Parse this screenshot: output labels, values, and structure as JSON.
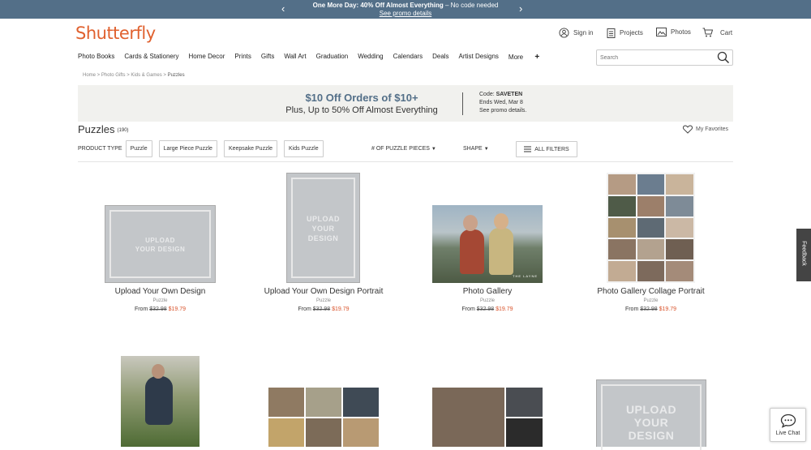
{
  "promo": {
    "bold": "One More Day: 40% Off Almost Everything",
    "normal": " – No code needed",
    "link": "See promo details"
  },
  "brand": "Shutterfly",
  "utility": {
    "signin": "Sign in",
    "projects": "Projects",
    "photos": "Photos",
    "cart": "Cart"
  },
  "nav": [
    "Photo Books",
    "Cards & Stationery",
    "Home Decor",
    "Prints",
    "Gifts",
    "Wall Art",
    "Graduation",
    "Wedding",
    "Calendars",
    "Deals",
    "Artist Designs",
    "More"
  ],
  "search": {
    "placeholder": "Search"
  },
  "breadcrumb": {
    "home": "Home",
    "gifts": "Photo Gifts",
    "kids": "Kids & Games",
    "current": "Puzzles"
  },
  "banner": {
    "headline": "$10 Off Orders of $10+",
    "subline": "Plus, Up to 50% Off Almost Everything",
    "code_prefix": "Code: ",
    "code": "SAVETEN",
    "ends": "Ends Wed, Mar 8",
    "link": "See promo details."
  },
  "page": {
    "title": "Puzzles",
    "count": "(190)",
    "favorites": "My Favorites"
  },
  "filters": {
    "label": "PRODUCT TYPE",
    "chips": [
      "Puzzle",
      "Large Piece Puzzle",
      "Keepsake Puzzle",
      "Kids Puzzle"
    ],
    "pieces": "# OF PUZZLE PIECES",
    "shape": "SHAPE",
    "all": "ALL FILTERS"
  },
  "products": [
    {
      "name": "Upload Your Own Design",
      "type": "Puzzle",
      "from": "From",
      "old": "$32.98",
      "price": "$19.79",
      "art": "UPLOAD\nYOUR DESIGN"
    },
    {
      "name": "Upload Your Own Design Portrait",
      "type": "Puzzle",
      "from": "From",
      "old": "$32.98",
      "price": "$19.79",
      "art": "UPLOAD\nYOUR\nDESIGN"
    },
    {
      "name": "Photo Gallery",
      "type": "Puzzle",
      "from": "From",
      "old": "$32.98",
      "price": "$19.79",
      "art": "THE LAYNE"
    },
    {
      "name": "Photo Gallery Collage Portrait",
      "type": "Puzzle",
      "from": "From",
      "old": "$32.98",
      "price": "$19.79"
    }
  ],
  "row2_art": "UPLOAD\nYOUR\nDESIGN",
  "feedback": "Feedback",
  "chat": "Live Chat",
  "colors": {
    "accent": "#e0612f",
    "promo_bg": "#536f88",
    "sale": "#d9532b"
  }
}
